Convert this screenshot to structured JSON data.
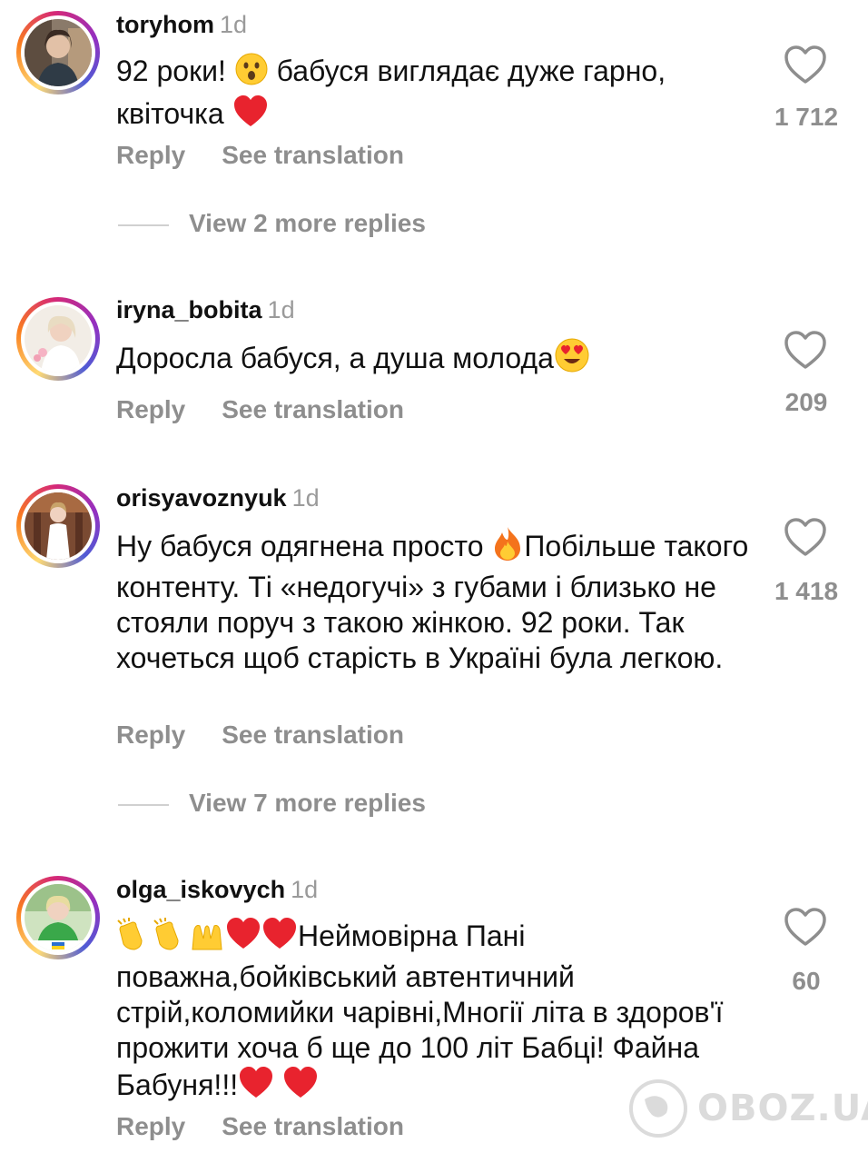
{
  "comments": [
    {
      "username": "toryhom",
      "time": "1d",
      "text_a": "92 роки! ",
      "text_b": " бабуся виглядає дуже гарно, квіточка ",
      "likes": "1 712",
      "reply_label": "Reply",
      "translation_label": "See translation",
      "more_replies": "View 2 more replies"
    },
    {
      "username": "iryna_bobita",
      "time": "1d",
      "text_a": "Доросла бабуся, а душа молода",
      "likes": "209",
      "reply_label": "Reply",
      "translation_label": "See translation"
    },
    {
      "username": "orisyavoznyuk",
      "time": "1d",
      "text_a": "Ну бабуся одягнена просто ",
      "text_b": "Побільше такого контенту. Ті «недогучі» з губами і близько не стояли поруч з такою жінкою. 92 роки. Так хочеться щоб старість в Україні була легкою.",
      "likes": "1 418",
      "reply_label": "Reply",
      "translation_label": "See translation",
      "more_replies": "View 7 more replies"
    },
    {
      "username": "olga_iskovych",
      "time": "1d",
      "text_a": "Неймовірна Пані поважна,бойківський автентичний стрій,коломийки чарівні,Многії літа в здоров'ї прожити хоча б ще до 100 літ Бабці! Файна Бабуня!!!",
      "likes": "60",
      "reply_label": "Reply",
      "translation_label": "See translation"
    }
  ],
  "watermark": "OBOZ.UA",
  "colors": {
    "heart_red": "#e8232e",
    "muted": "#8e8e8e",
    "emoji_yellow": "#ffcc33"
  },
  "icons": {
    "like": "heart-outline-icon"
  }
}
